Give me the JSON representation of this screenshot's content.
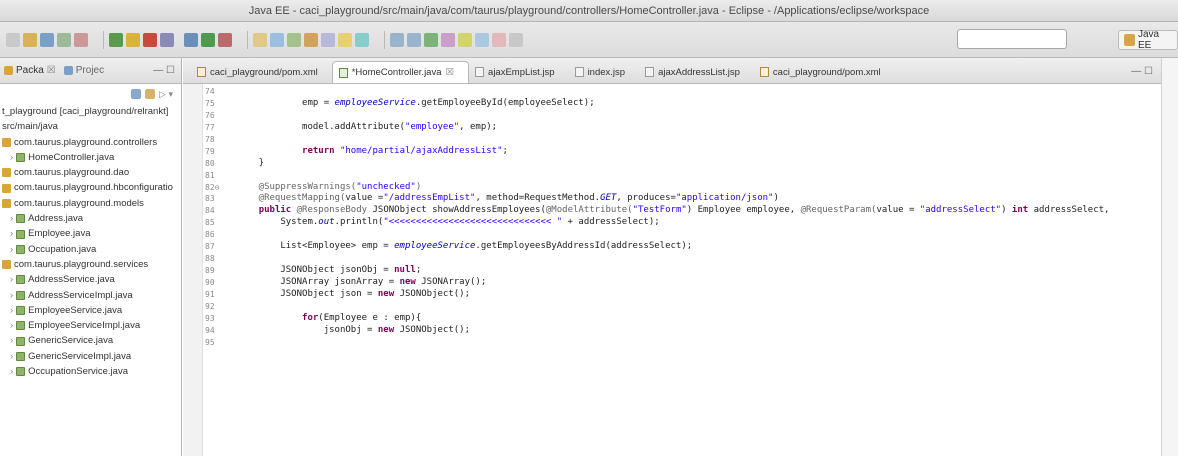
{
  "window": {
    "title": "Java EE - caci_playground/src/main/java/com/taurus/playground/controllers/HomeController.java - Eclipse - /Applications/eclipse/workspace"
  },
  "toolbar": {
    "quick_access_placeholder": "",
    "perspective_label": "Java EE"
  },
  "sidebar": {
    "tabs": [
      {
        "label": "Packa",
        "icon": "package-explorer-icon"
      },
      {
        "label": "Projec",
        "icon": "project-explorer-icon"
      }
    ],
    "tree": [
      {
        "label": "t_playground [caci_playground/relrankt]",
        "icon": "none"
      },
      {
        "label": "src/main/java",
        "icon": "none"
      },
      {
        "label": "com.taurus.playground.controllers",
        "icon": "package"
      },
      {
        "label": "HomeController.java",
        "icon": "java"
      },
      {
        "label": "com.taurus.playground.dao",
        "icon": "package"
      },
      {
        "label": "com.taurus.playground.hbconfiguratio",
        "icon": "package"
      },
      {
        "label": "com.taurus.playground.models",
        "icon": "package"
      },
      {
        "label": "Address.java",
        "icon": "java"
      },
      {
        "label": "Employee.java",
        "icon": "java"
      },
      {
        "label": "Occupation.java",
        "icon": "java"
      },
      {
        "label": "com.taurus.playground.services",
        "icon": "package"
      },
      {
        "label": "AddressService.java",
        "icon": "java"
      },
      {
        "label": "AddressServiceImpl.java",
        "icon": "java"
      },
      {
        "label": "EmployeeService.java",
        "icon": "java"
      },
      {
        "label": "EmployeeServiceImpl.java",
        "icon": "java"
      },
      {
        "label": "GenericService.java",
        "icon": "java"
      },
      {
        "label": "GenericServiceImpl.java",
        "icon": "java"
      },
      {
        "label": "OccupationService.java",
        "icon": "java"
      }
    ]
  },
  "editor": {
    "tabs": [
      {
        "label": "caci_playground/pom.xml",
        "type": "xml",
        "active": false
      },
      {
        "label": "*HomeController.java",
        "type": "java",
        "active": true
      },
      {
        "label": "ajaxEmpList.jsp",
        "type": "jsp",
        "active": false
      },
      {
        "label": "index.jsp",
        "type": "jsp",
        "active": false
      },
      {
        "label": "ajaxAddressList.jsp",
        "type": "jsp",
        "active": false
      },
      {
        "label": "caci_playground/pom.xml",
        "type": "xml",
        "active": false
      }
    ],
    "lines": [
      {
        "num": "74",
        "segs": []
      },
      {
        "num": "75",
        "segs": [
          {
            "t": "            emp = ",
            "c": "plain"
          },
          {
            "t": "employeeService",
            "c": "fld"
          },
          {
            "t": ".getEmployeeById(employeeSelect);",
            "c": "plain"
          }
        ]
      },
      {
        "num": "76",
        "segs": []
      },
      {
        "num": "77",
        "segs": [
          {
            "t": "            model.addAttribute(",
            "c": "plain"
          },
          {
            "t": "\"employee\"",
            "c": "str"
          },
          {
            "t": ", emp);",
            "c": "plain"
          }
        ]
      },
      {
        "num": "78",
        "segs": []
      },
      {
        "num": "79",
        "segs": [
          {
            "t": "            ",
            "c": "plain"
          },
          {
            "t": "return",
            "c": "kw"
          },
          {
            "t": " ",
            "c": "plain"
          },
          {
            "t": "\"home/partial/ajaxAddressList\"",
            "c": "str"
          },
          {
            "t": ";",
            "c": "plain"
          }
        ]
      },
      {
        "num": "80",
        "segs": [
          {
            "t": "    }",
            "c": "plain"
          }
        ]
      },
      {
        "num": "81",
        "segs": []
      },
      {
        "num": "82⊖",
        "segs": [
          {
            "t": "    @SuppressWarnings(",
            "c": "ann"
          },
          {
            "t": "\"unchecked\"",
            "c": "str"
          },
          {
            "t": ")",
            "c": "ann"
          }
        ]
      },
      {
        "num": "83",
        "segs": [
          {
            "t": "    @RequestMapping(",
            "c": "ann"
          },
          {
            "t": "value =",
            "c": "plain"
          },
          {
            "t": "\"/addressEmpList\"",
            "c": "str"
          },
          {
            "t": ", method=RequestMethod.",
            "c": "plain"
          },
          {
            "t": "GET",
            "c": "fld"
          },
          {
            "t": ", produces=",
            "c": "plain"
          },
          {
            "t": "\"application/json\"",
            "c": "str"
          },
          {
            "t": ")",
            "c": "plain"
          }
        ]
      },
      {
        "num": "84",
        "segs": [
          {
            "t": "    ",
            "c": "plain"
          },
          {
            "t": "public",
            "c": "kw"
          },
          {
            "t": " ",
            "c": "plain"
          },
          {
            "t": "@ResponseBody",
            "c": "ann"
          },
          {
            "t": " JSONObject showAddressEmployees(",
            "c": "plain"
          },
          {
            "t": "@ModelAttribute(",
            "c": "ann"
          },
          {
            "t": "\"TestForm\"",
            "c": "str"
          },
          {
            "t": ") Employee employee, ",
            "c": "plain"
          },
          {
            "t": "@RequestParam(",
            "c": "ann"
          },
          {
            "t": "value = ",
            "c": "plain"
          },
          {
            "t": "\"addressSelect\"",
            "c": "str"
          },
          {
            "t": ") ",
            "c": "plain"
          },
          {
            "t": "int",
            "c": "kw"
          },
          {
            "t": " addressSelect,",
            "c": "plain"
          }
        ]
      },
      {
        "num": "85",
        "segs": [
          {
            "t": "        System.",
            "c": "plain"
          },
          {
            "t": "out",
            "c": "fld"
          },
          {
            "t": ".println(",
            "c": "plain"
          },
          {
            "t": "\"<<<<<<<<<<<<<<<<<<<<<<<<<<<<<< \"",
            "c": "str"
          },
          {
            "t": " + addressSelect);",
            "c": "plain"
          }
        ]
      },
      {
        "num": "86",
        "segs": []
      },
      {
        "num": "87",
        "segs": [
          {
            "t": "        List<Employee> emp = ",
            "c": "plain"
          },
          {
            "t": "employeeService",
            "c": "fld"
          },
          {
            "t": ".getEmployeesByAddressId(addressSelect);",
            "c": "plain"
          }
        ]
      },
      {
        "num": "88",
        "segs": []
      },
      {
        "num": "89",
        "segs": [
          {
            "t": "        JSONObject jsonObj = ",
            "c": "plain"
          },
          {
            "t": "null",
            "c": "kw"
          },
          {
            "t": ";",
            "c": "plain"
          }
        ]
      },
      {
        "num": "90",
        "segs": [
          {
            "t": "        JSONArray jsonArray = ",
            "c": "plain"
          },
          {
            "t": "new",
            "c": "kw"
          },
          {
            "t": " JSONArray();",
            "c": "plain"
          }
        ]
      },
      {
        "num": "91",
        "segs": [
          {
            "t": "        JSONObject json = ",
            "c": "plain"
          },
          {
            "t": "new",
            "c": "kw"
          },
          {
            "t": " JSONObject();",
            "c": "plain"
          }
        ]
      },
      {
        "num": "92",
        "segs": []
      },
      {
        "num": "93",
        "segs": [
          {
            "t": "            ",
            "c": "plain"
          },
          {
            "t": "for",
            "c": "kw"
          },
          {
            "t": "(Employee e : emp){",
            "c": "plain"
          }
        ]
      },
      {
        "num": "94",
        "segs": [
          {
            "t": "                jsonObj = ",
            "c": "plain"
          },
          {
            "t": "new",
            "c": "kw"
          },
          {
            "t": " JSONObject();",
            "c": "plain"
          }
        ]
      },
      {
        "num": "95",
        "segs": []
      }
    ]
  },
  "colors": {
    "keyword": "#7f0055",
    "string": "#2a00ff",
    "annotation": "#646464",
    "field": "#0000c0"
  }
}
